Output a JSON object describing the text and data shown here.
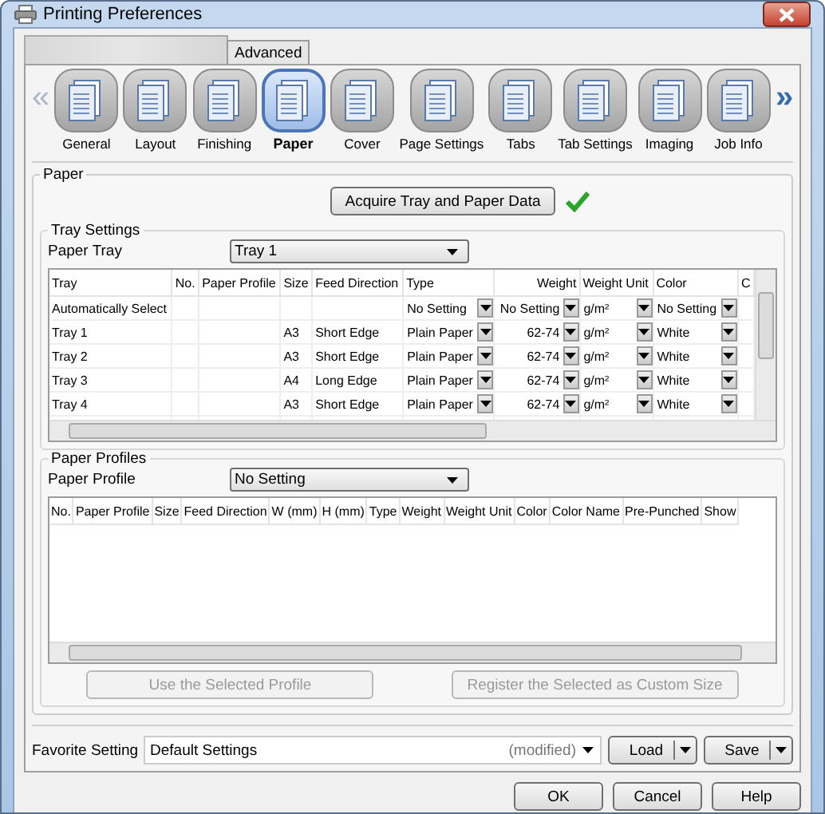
{
  "window": {
    "title": "Printing Preferences"
  },
  "tabs": [
    {
      "kind": "blank",
      "selected": true
    },
    {
      "kind": "text",
      "label": "Advanced",
      "selected": false
    }
  ],
  "nav": {
    "prev": "«",
    "next": "»"
  },
  "categories": [
    {
      "label": "General",
      "selected": false
    },
    {
      "label": "Layout",
      "selected": false
    },
    {
      "label": "Finishing",
      "selected": false
    },
    {
      "label": "Paper",
      "selected": true
    },
    {
      "label": "Cover",
      "selected": false
    },
    {
      "label": "Page Settings",
      "selected": false
    },
    {
      "label": "Tabs",
      "selected": false
    },
    {
      "label": "Tab Settings",
      "selected": false
    },
    {
      "label": "Imaging",
      "selected": false
    },
    {
      "label": "Job Info",
      "selected": false
    }
  ],
  "paper": {
    "title": "Paper",
    "acquire_button": "Acquire Tray and Paper Data",
    "acquired": true,
    "tray_settings": {
      "title": "Tray Settings",
      "label": "Paper Tray",
      "value": "Tray 1",
      "columns": [
        "Tray",
        "No.",
        "Paper Profile",
        "Size",
        "Feed Direction",
        "Type",
        "Weight",
        "Weight Unit",
        "Color",
        "C"
      ],
      "rows": [
        {
          "tray": "Automatically Select",
          "size": "",
          "feed": "",
          "type": "No Setting",
          "weight": "No Setting",
          "unit": "g/m²",
          "paper_color": "No Setting"
        },
        {
          "tray": "Tray 1",
          "size": "A3",
          "feed": "Short Edge",
          "type": "Plain Paper",
          "weight": "62-74",
          "unit": "g/m²",
          "paper_color": "White"
        },
        {
          "tray": "Tray 2",
          "size": "A3",
          "feed": "Short Edge",
          "type": "Plain Paper",
          "weight": "62-74",
          "unit": "g/m²",
          "paper_color": "White"
        },
        {
          "tray": "Tray 3",
          "size": "A4",
          "feed": "Long Edge",
          "type": "Plain Paper",
          "weight": "62-74",
          "unit": "g/m²",
          "paper_color": "White"
        },
        {
          "tray": "Tray 4",
          "size": "A3",
          "feed": "Short Edge",
          "type": "Plain Paper",
          "weight": "62-74",
          "unit": "g/m²",
          "paper_color": "White"
        }
      ]
    },
    "profiles": {
      "title": "Paper Profiles",
      "label": "Paper Profile",
      "value": "No Setting",
      "columns": [
        "No.",
        "Paper Profile",
        "Size",
        "Feed Direction",
        "W (mm)",
        "H (mm)",
        "Type",
        "Weight",
        "Weight Unit",
        "Color",
        "Color Name",
        "Pre-Punched",
        "Show"
      ],
      "use_button": {
        "label": "Use the Selected Profile",
        "disabled": true
      },
      "register_button": {
        "label": "Register the Selected as Custom Size",
        "disabled": true
      }
    }
  },
  "favorite": {
    "label": "Favorite Setting",
    "value": "Default Settings",
    "status": "(modified)",
    "load": "Load",
    "save": "Save"
  },
  "buttons": [
    "OK",
    "Cancel",
    "Help"
  ]
}
